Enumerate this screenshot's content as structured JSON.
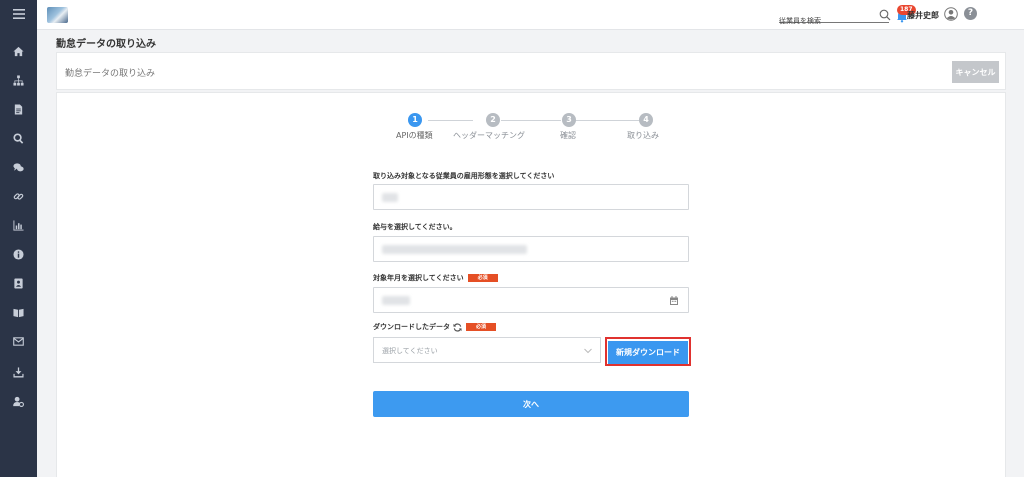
{
  "sidebar": {
    "items": [
      {
        "icon": "menu-icon"
      },
      {
        "icon": "home-icon"
      },
      {
        "icon": "org-chart-icon"
      },
      {
        "icon": "document-icon"
      },
      {
        "icon": "search-icon"
      },
      {
        "icon": "chat-icon"
      },
      {
        "icon": "link-icon"
      },
      {
        "icon": "bar-chart-icon"
      },
      {
        "icon": "info-icon"
      },
      {
        "icon": "contact-card-icon"
      },
      {
        "icon": "book-icon"
      },
      {
        "icon": "mail-icon"
      },
      {
        "icon": "download-icon"
      },
      {
        "icon": "user-settings-icon"
      }
    ]
  },
  "header": {
    "search_placeholder": "従業員を検索",
    "notification_count": "187",
    "user_name": "藤井史郎",
    "help_label": "?"
  },
  "page": {
    "title": "勤怠データの取り込み",
    "card_title": "勤怠データの取り込み",
    "cancel_label": "キャンセル"
  },
  "stepper": {
    "steps": [
      {
        "number": "1",
        "label": "APIの種類",
        "active": true
      },
      {
        "number": "2",
        "label": "ヘッダーマッチング",
        "active": false
      },
      {
        "number": "3",
        "label": "確認",
        "active": false
      },
      {
        "number": "4",
        "label": "取り込み",
        "active": false
      }
    ]
  },
  "form": {
    "employment_type_label": "取り込み対象となる従業員の雇用形態を選択してください",
    "salary_label": "給与を選択してください。",
    "target_month_label": "対象年月を選択してください",
    "required_badge": "必須",
    "download_data_label": "ダウンロードしたデータ",
    "select_placeholder": "選択してください",
    "new_download_label": "新規ダウンロード",
    "next_label": "次へ"
  },
  "colors": {
    "sidebar_bg": "#2b3447",
    "primary": "#3a97f0",
    "required": "#e54f25",
    "highlight_border": "#e0322f",
    "badge": "#e9462f"
  }
}
